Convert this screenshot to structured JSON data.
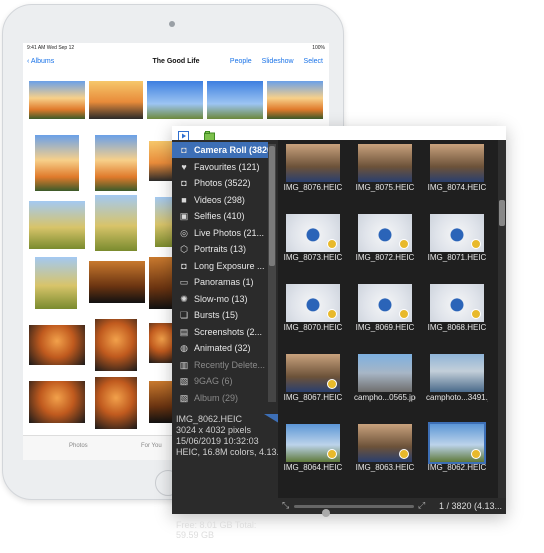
{
  "ipad": {
    "status_left": "9:41 AM  Wed Sep 12",
    "status_right": "100%",
    "nav": {
      "back": "Albums",
      "title": "The Good Life",
      "actions": [
        "People",
        "Slideshow",
        "Select"
      ]
    },
    "tabs": {
      "photos": "Photos",
      "for_you": "For You"
    }
  },
  "sidebar": {
    "items": [
      {
        "label": "Camera Roll (3820)",
        "icon": "camera-icon",
        "selected": true,
        "dim": false
      },
      {
        "label": "Favourites (121)",
        "icon": "heart-icon",
        "selected": false,
        "dim": false
      },
      {
        "label": "Photos (3522)",
        "icon": "camera-icon",
        "selected": false,
        "dim": false
      },
      {
        "label": "Videos (298)",
        "icon": "video-icon",
        "selected": false,
        "dim": false
      },
      {
        "label": "Selfies (410)",
        "icon": "selfie-icon",
        "selected": false,
        "dim": false
      },
      {
        "label": "Live Photos (21...",
        "icon": "live-photo-icon",
        "selected": false,
        "dim": false
      },
      {
        "label": "Portraits (13)",
        "icon": "cube-icon",
        "selected": false,
        "dim": false
      },
      {
        "label": "Long Exposure ...",
        "icon": "camera-icon",
        "selected": false,
        "dim": false
      },
      {
        "label": "Panoramas (1)",
        "icon": "panorama-icon",
        "selected": false,
        "dim": false
      },
      {
        "label": "Slow-mo (13)",
        "icon": "slowmo-icon",
        "selected": false,
        "dim": false
      },
      {
        "label": "Bursts (15)",
        "icon": "burst-icon",
        "selected": false,
        "dim": false
      },
      {
        "label": "Screenshots (2...",
        "icon": "screenshot-icon",
        "selected": false,
        "dim": false
      },
      {
        "label": "Animated (32)",
        "icon": "animated-icon",
        "selected": false,
        "dim": false
      },
      {
        "label": "Recently Delete...",
        "icon": "trash-icon",
        "selected": false,
        "dim": true
      },
      {
        "label": "9GAG (6)",
        "icon": "album-icon",
        "selected": false,
        "dim": true
      },
      {
        "label": "Album (29)",
        "icon": "album-icon",
        "selected": false,
        "dim": true
      }
    ],
    "info": {
      "filename": "IMG_8062.HEIC",
      "dimensions": "3024 x 4032 pixels",
      "date": "15/06/2019 10:32:03",
      "format": "HEIC, 16.8M colors, 4.13..."
    },
    "free_space": "Free: 8.01 GB Total: 59.59 GB"
  },
  "grid": {
    "rows": [
      [
        {
          "name": "IMG_8076.HEIC",
          "kind": "selfie"
        },
        {
          "name": "IMG_8075.HEIC",
          "kind": "selfie"
        },
        {
          "name": "IMG_8074.HEIC",
          "kind": "selfie"
        }
      ],
      [
        {
          "name": "IMG_8073.HEIC",
          "kind": "angel"
        },
        {
          "name": "IMG_8072.HEIC",
          "kind": "angel"
        },
        {
          "name": "IMG_8071.HEIC",
          "kind": "angel"
        }
      ],
      [
        {
          "name": "IMG_8070.HEIC",
          "kind": "angel"
        },
        {
          "name": "IMG_8069.HEIC",
          "kind": "angel"
        },
        {
          "name": "IMG_8068.HEIC",
          "kind": "angel"
        }
      ],
      [
        {
          "name": "IMG_8067.HEIC",
          "kind": "selfie"
        },
        {
          "name": "campho...0565.jpg",
          "kind": "street"
        },
        {
          "name": "camphoto...3491.jpg",
          "kind": "city"
        }
      ],
      [
        {
          "name": "IMG_8064.HEIC",
          "kind": "sky2"
        },
        {
          "name": "IMG_8063.HEIC",
          "kind": "selfie"
        },
        {
          "name": "IMG_8062.HEIC",
          "kind": "sky2",
          "selected": true
        }
      ]
    ],
    "count": "1 / 3820 (4.13..."
  },
  "colors": {
    "accent": "#3d6fb6",
    "sidebar_bg": "#2b2b2b",
    "grid_bg": "#1f1f1f",
    "ios_blue": "#1a73e8"
  }
}
